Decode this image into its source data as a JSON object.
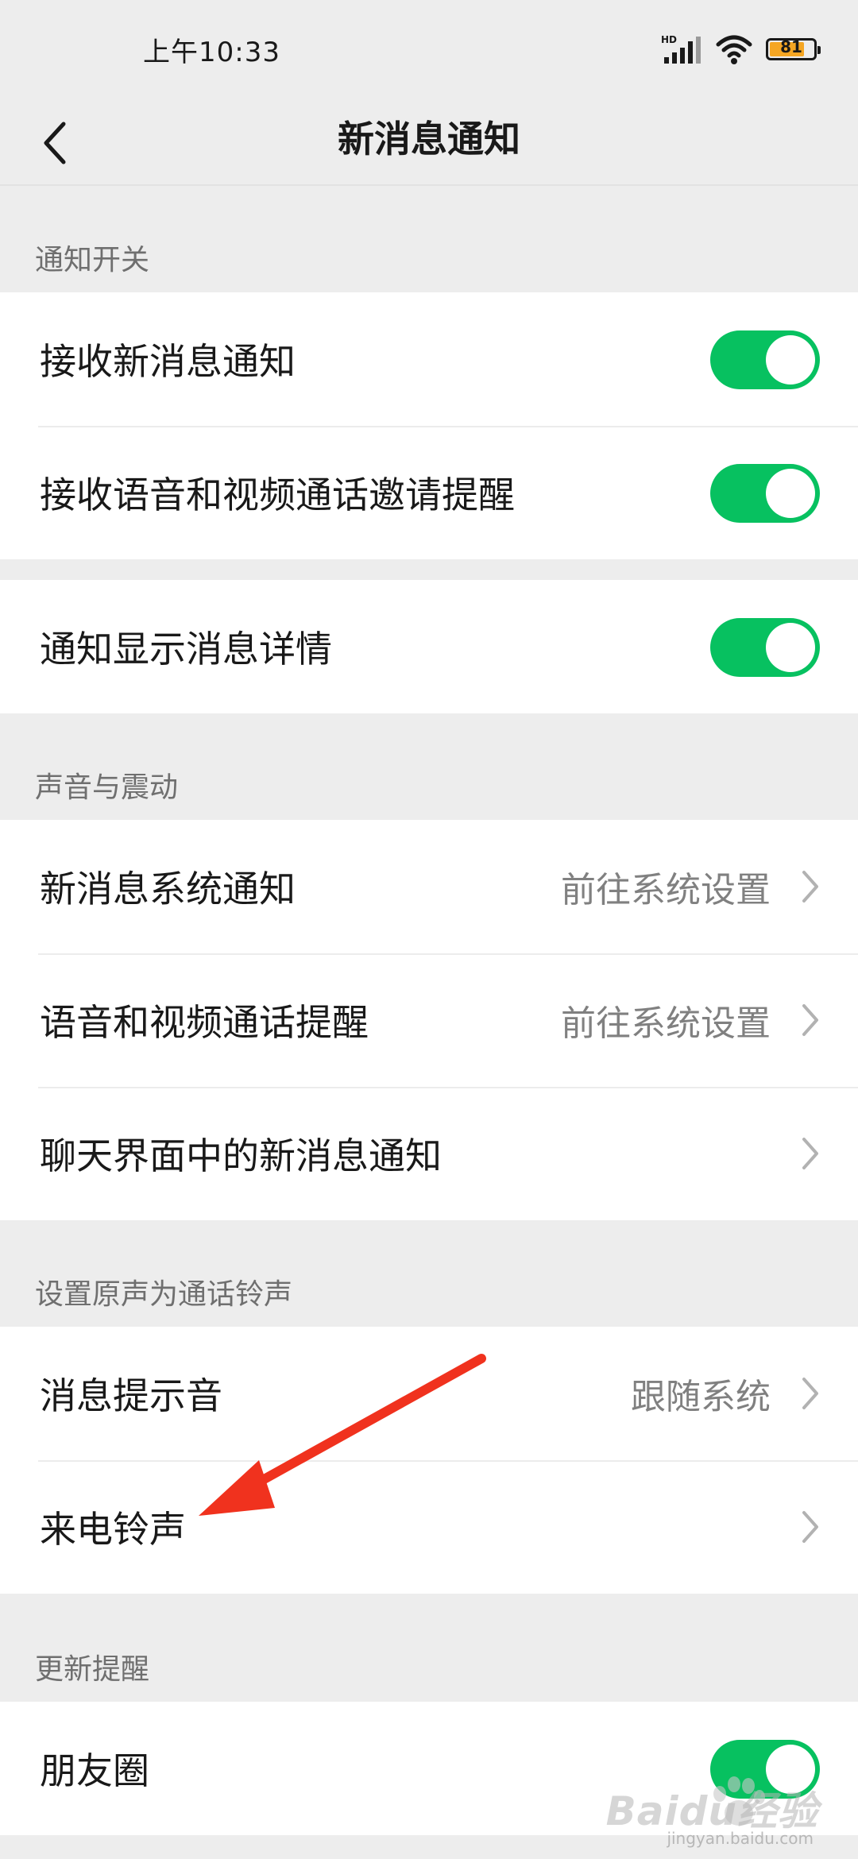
{
  "status_bar": {
    "time": "上午10:33",
    "battery_level": 81,
    "battery_text": "81",
    "network_label": "HD",
    "icons": [
      "signal-icon",
      "wifi-icon",
      "battery-icon"
    ]
  },
  "nav": {
    "title": "新消息通知",
    "back_icon": "chevron-left-icon"
  },
  "sections": {
    "notify_switch": {
      "header": "通知开关",
      "rows": [
        {
          "label": "接收新消息通知",
          "toggle": true
        },
        {
          "label": "接收语音和视频通话邀请提醒",
          "toggle": true
        }
      ]
    },
    "detail": {
      "rows": [
        {
          "label": "通知显示消息详情",
          "toggle": true
        }
      ]
    },
    "sound": {
      "header": "声音与震动",
      "rows": [
        {
          "label": "新消息系统通知",
          "value": "前往系统设置"
        },
        {
          "label": "语音和视频通话提醒",
          "value": "前往系统设置"
        },
        {
          "label": "聊天界面中的新消息通知",
          "value": ""
        }
      ]
    },
    "ringtone": {
      "header": "设置原声为通话铃声",
      "rows": [
        {
          "label": "消息提示音",
          "value": "跟随系统"
        },
        {
          "label": "来电铃声",
          "value": ""
        }
      ]
    },
    "update": {
      "header": "更新提醒",
      "rows": [
        {
          "label": "朋友圈",
          "toggle": true
        }
      ]
    }
  },
  "colors": {
    "accent": "#07c160",
    "background": "#ededed",
    "annotation": "#f0321e"
  },
  "watermark": {
    "brand": "Baidu经验",
    "site": "jingyan.baidu.com"
  }
}
